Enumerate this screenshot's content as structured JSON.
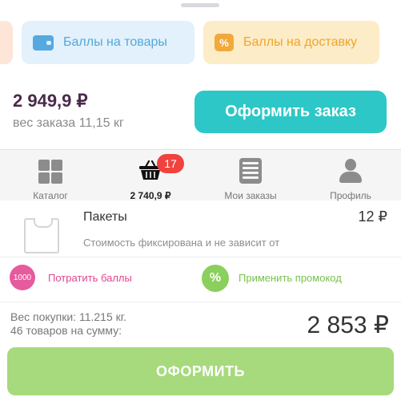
{
  "chips": {
    "points_label": "Баллы на товары",
    "points_icon": "wallet-icon",
    "delivery_label": "Баллы на доставку",
    "delivery_icon_glyph": "%"
  },
  "order": {
    "total": "2 949,9 ₽",
    "weight": "вес заказа 11,15 кг",
    "checkout_label": "Оформить заказ"
  },
  "tabbar": {
    "tabs": [
      {
        "label": "Каталог",
        "icon": "grid-icon"
      },
      {
        "label": "2 740,9 ₽",
        "icon": "basket-icon",
        "active": true,
        "badge": "17"
      },
      {
        "label": "Мои заказы",
        "icon": "list-icon"
      },
      {
        "label": "Профиль",
        "icon": "user-icon"
      }
    ]
  },
  "product": {
    "name": "Пакеты",
    "price": "12 ₽",
    "note": "Стоимость фиксирована и не зависит от"
  },
  "actions": {
    "spend_icon_text": "1000",
    "spend_label": "Потратить баллы",
    "promo_icon_glyph": "%",
    "promo_label": "Применить промокод"
  },
  "summary": {
    "weight": "Вес покупки: 11.215 кг.",
    "count": "46 товаров на сумму:",
    "total": "2 853 ₽"
  },
  "checkout_bottom_label": "ОФОРМИТЬ",
  "colors": {
    "accent_teal": "#2ec7c7",
    "badge_red": "#f0433d",
    "spend_pink": "#e55b9e",
    "promo_green": "#8bcf5c",
    "checkout_green": "#a6da7c"
  }
}
